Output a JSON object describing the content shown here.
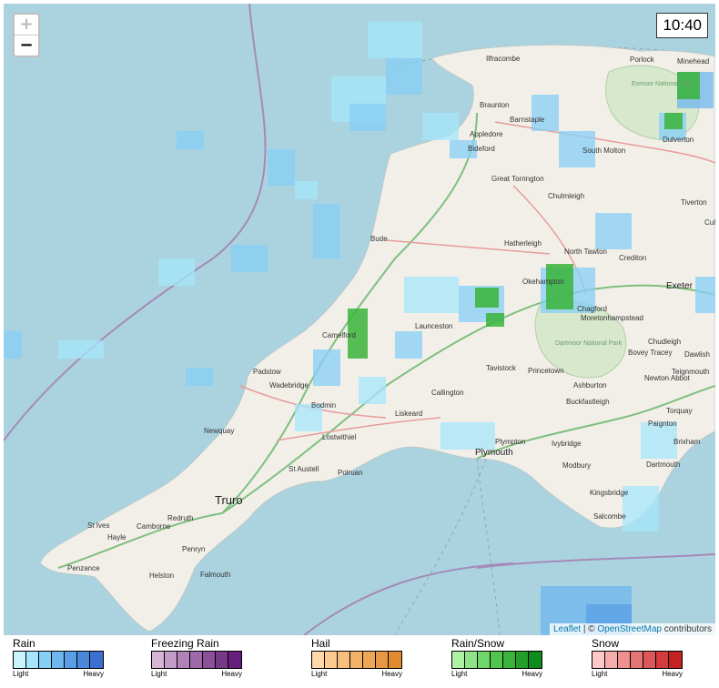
{
  "map": {
    "time": "10:40",
    "zoom_in": "+",
    "zoom_out": "−",
    "attribution": {
      "leaflet": "Leaflet",
      "separator": " | © ",
      "osm": "OpenStreetMap",
      "suffix": " contributors"
    },
    "places": [
      {
        "name": "Ilfracombe",
        "cls": ""
      },
      {
        "name": "Porlock",
        "cls": ""
      },
      {
        "name": "Minehead",
        "cls": ""
      },
      {
        "name": "Braunton",
        "cls": ""
      },
      {
        "name": "Barnstaple",
        "cls": ""
      },
      {
        "name": "Appledore",
        "cls": ""
      },
      {
        "name": "Bideford",
        "cls": ""
      },
      {
        "name": "South Molton",
        "cls": ""
      },
      {
        "name": "Dulverton",
        "cls": ""
      },
      {
        "name": "Great Torrington",
        "cls": ""
      },
      {
        "name": "Chulmleigh",
        "cls": ""
      },
      {
        "name": "Tiverton",
        "cls": ""
      },
      {
        "name": "Bude",
        "cls": ""
      },
      {
        "name": "Hatherleigh",
        "cls": ""
      },
      {
        "name": "North Tawton",
        "cls": ""
      },
      {
        "name": "Crediton",
        "cls": ""
      },
      {
        "name": "Okehampton",
        "cls": ""
      },
      {
        "name": "Exeter",
        "cls": "mid"
      },
      {
        "name": "Chagford",
        "cls": ""
      },
      {
        "name": "Moretonhampstead",
        "cls": ""
      },
      {
        "name": "Camelford",
        "cls": ""
      },
      {
        "name": "Launceston",
        "cls": ""
      },
      {
        "name": "Chudleigh",
        "cls": ""
      },
      {
        "name": "Bovey Tracey",
        "cls": ""
      },
      {
        "name": "Dawlish",
        "cls": ""
      },
      {
        "name": "Padstow",
        "cls": ""
      },
      {
        "name": "Wadebridge",
        "cls": ""
      },
      {
        "name": "Tavistock",
        "cls": ""
      },
      {
        "name": "Princetown",
        "cls": ""
      },
      {
        "name": "Teignmouth",
        "cls": ""
      },
      {
        "name": "Newton Abbot",
        "cls": ""
      },
      {
        "name": "Ashburton",
        "cls": ""
      },
      {
        "name": "Callington",
        "cls": ""
      },
      {
        "name": "Bodmin",
        "cls": ""
      },
      {
        "name": "Buckfastleigh",
        "cls": ""
      },
      {
        "name": "Torquay",
        "cls": ""
      },
      {
        "name": "Liskeard",
        "cls": ""
      },
      {
        "name": "Lostwithiel",
        "cls": ""
      },
      {
        "name": "Paignton",
        "cls": ""
      },
      {
        "name": "Newquay",
        "cls": ""
      },
      {
        "name": "Plymouth",
        "cls": "mid"
      },
      {
        "name": "Plympton",
        "cls": ""
      },
      {
        "name": "Ivybridge",
        "cls": ""
      },
      {
        "name": "Brixham",
        "cls": ""
      },
      {
        "name": "Dartmouth",
        "cls": ""
      },
      {
        "name": "St Austell",
        "cls": ""
      },
      {
        "name": "Polruan",
        "cls": ""
      },
      {
        "name": "Modbury",
        "cls": ""
      },
      {
        "name": "Truro",
        "cls": "big"
      },
      {
        "name": "Kingsbridge",
        "cls": ""
      },
      {
        "name": "Redruth",
        "cls": ""
      },
      {
        "name": "St Ives",
        "cls": ""
      },
      {
        "name": "Camborne",
        "cls": ""
      },
      {
        "name": "Salcombe",
        "cls": ""
      },
      {
        "name": "Hayle",
        "cls": ""
      },
      {
        "name": "Penryn",
        "cls": ""
      },
      {
        "name": "Falmouth",
        "cls": ""
      },
      {
        "name": "Penzance",
        "cls": ""
      },
      {
        "name": "Helston",
        "cls": ""
      },
      {
        "name": "Cullompton",
        "cls": ""
      },
      {
        "name": "Exmoor National Park",
        "cls": "park"
      },
      {
        "name": "Dartmoor National Park",
        "cls": "park"
      }
    ]
  },
  "legend": [
    {
      "title": "Rain",
      "light": "Light",
      "heavy": "Heavy",
      "colors": [
        "#c8f4ff",
        "#a6e5fb",
        "#86cff5",
        "#6db6ee",
        "#5a9fe6",
        "#4a88dc",
        "#3b6fd0"
      ]
    },
    {
      "title": "Freezing Rain",
      "light": "Light",
      "heavy": "Heavy",
      "colors": [
        "#d7b5d6",
        "#c39bc7",
        "#b182b8",
        "#9e69a8",
        "#8b5098",
        "#783888",
        "#661f7a"
      ]
    },
    {
      "title": "Hail",
      "light": "Light",
      "heavy": "Heavy",
      "colors": [
        "#ffd7a8",
        "#fccb90",
        "#f7bf7c",
        "#f2b268",
        "#eda556",
        "#e89844",
        "#e08b30"
      ]
    },
    {
      "title": "Rain/Snow",
      "light": "Light",
      "heavy": "Heavy",
      "colors": [
        "#aef0a4",
        "#8fe487",
        "#6fd66a",
        "#52c54f",
        "#39b43a",
        "#23a02a",
        "#108c1c"
      ]
    },
    {
      "title": "Snow",
      "light": "Light",
      "heavy": "Heavy",
      "colors": [
        "#ffc8c8",
        "#f6acac",
        "#ee9090",
        "#e57474",
        "#dc5858",
        "#d23c3c",
        "#c42222"
      ]
    }
  ]
}
